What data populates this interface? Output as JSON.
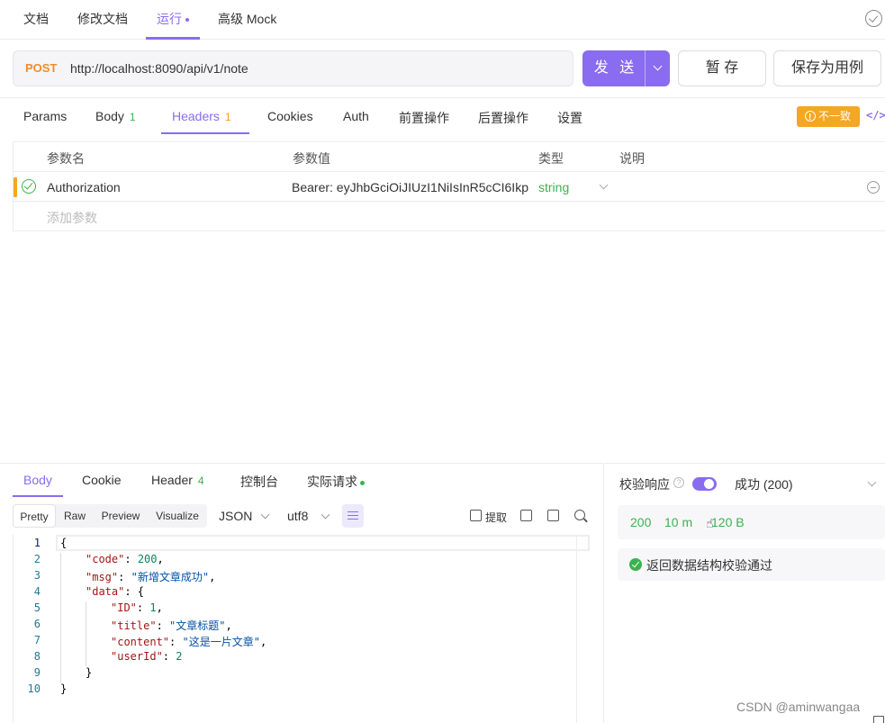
{
  "top_tabs": {
    "doc": "文档",
    "edit_doc": "修改文档",
    "run": "运行",
    "mock": "高级 Mock"
  },
  "request": {
    "method": "POST",
    "url": "http://localhost:8090/api/v1/note",
    "send_label": "发 送",
    "save_label": "暂 存",
    "save_as_case_label": "保存为用例"
  },
  "req_tabs": {
    "params": "Params",
    "body": "Body",
    "body_count": "1",
    "headers": "Headers",
    "headers_count": "1",
    "cookies": "Cookies",
    "auth": "Auth",
    "pre": "前置操作",
    "post": "后置操作",
    "settings": "设置",
    "mismatch": "不一致",
    "code_icon": "</>"
  },
  "headers_table": {
    "columns": [
      "参数名",
      "参数值",
      "类型",
      "说明"
    ],
    "rows": [
      {
        "name": "Authorization",
        "value": "Bearer: eyJhbGciOiJIUzI1NiIsInR5cCI6Ikp",
        "type": "string",
        "desc": ""
      }
    ],
    "add_placeholder": "添加参数"
  },
  "resp_tabs": {
    "body": "Body",
    "cookie": "Cookie",
    "header": "Header",
    "header_count": "4",
    "console": "控制台",
    "actual_request": "实际请求"
  },
  "resp_toolbar": {
    "formats": [
      "Pretty",
      "Raw",
      "Preview",
      "Visualize"
    ],
    "active_format": "Pretty",
    "lang": "JSON",
    "encoding": "utf8",
    "extract": "提取"
  },
  "response_body": {
    "line_numbers": [
      "1",
      "2",
      "3",
      "4",
      "5",
      "6",
      "7",
      "8",
      "9",
      "10"
    ],
    "code": 200,
    "msg": "新增文章成功",
    "data": {
      "ID": 1,
      "title": "文章标题",
      "content": "这是一片文章",
      "userId": 2
    }
  },
  "verify": {
    "label": "校验响应",
    "result": "成功 (200)",
    "status_code": "200",
    "time": "10 m",
    "size": "120 B",
    "message": "返回数据结构校验通过",
    "enabled": true
  },
  "watermark": "CSDN @aminwangaa",
  "colors": {
    "accent": "#8a6cf0",
    "method": "#f38b29",
    "success": "#3bb24f",
    "warning": "#f5a623"
  }
}
